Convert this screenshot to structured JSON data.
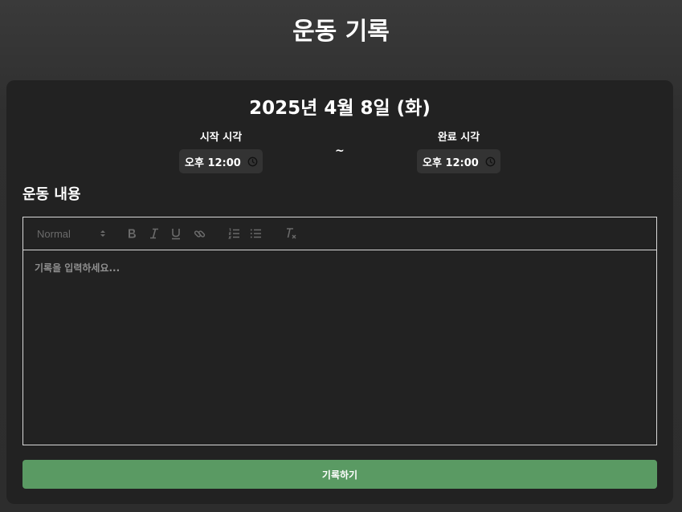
{
  "page": {
    "title": "운동 기록"
  },
  "record": {
    "date": "2025년 4월 8일 (화)",
    "start": {
      "label": "시작 시각",
      "value": "오후 12:00"
    },
    "separator": "~",
    "end": {
      "label": "완료 시각",
      "value": "오후 12:00"
    }
  },
  "content": {
    "section_title": "운동 내용",
    "toolbar": {
      "format_value": "Normal",
      "buttons": [
        "bold-icon",
        "italic-icon",
        "underline-icon",
        "link-icon",
        "ordered-list-icon",
        "bullet-list-icon",
        "clear-format-icon"
      ]
    },
    "editor_placeholder": "기록을 입력하세요..."
  },
  "actions": {
    "submit_label": "기록하기"
  },
  "colors": {
    "card_bg": "#222222",
    "submit_bg": "#5a9a63",
    "time_input_bg": "#333333",
    "border": "#d9d9d9"
  }
}
